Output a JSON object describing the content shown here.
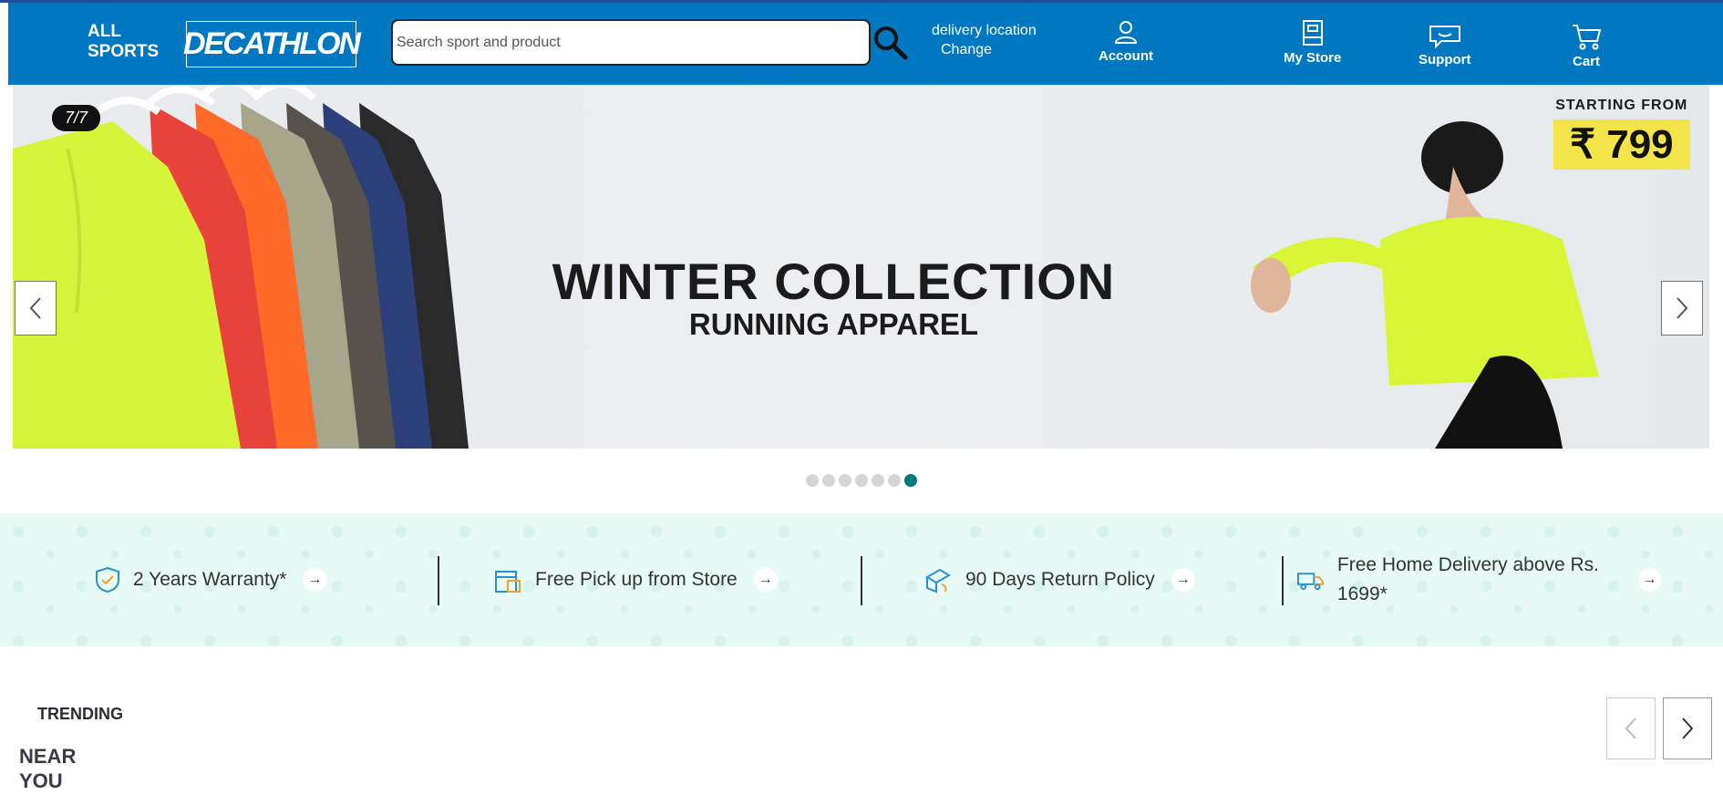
{
  "header": {
    "all_sports": "ALL SPORTS",
    "logo": "DECATHLON",
    "search_placeholder": "Search sport and product",
    "delivery_label": "delivery location",
    "delivery_change": "Change",
    "nav": [
      {
        "label": "Account",
        "icon": "user-icon"
      },
      {
        "label": "My Store",
        "icon": "store-icon"
      },
      {
        "label": "Support",
        "icon": "chat-icon"
      },
      {
        "label": "Cart",
        "icon": "cart-icon"
      }
    ]
  },
  "banner": {
    "pager": "7/7",
    "headline": "WINTER COLLECTION",
    "subheadline": "RUNNING APPAREL",
    "starting_from": "STARTING FROM",
    "price": "₹ 799",
    "dots_total": 7,
    "dots_active": 7
  },
  "features": [
    {
      "label": "2 Years Warranty*",
      "icon": "shield-check-icon"
    },
    {
      "label": "Free Pick up from Store",
      "icon": "store-pickup-icon"
    },
    {
      "label": "90 Days Return Policy",
      "icon": "return-box-icon"
    },
    {
      "label": "Free Home Delivery above Rs. 1699*",
      "icon": "delivery-truck-icon"
    }
  ],
  "section": {
    "trending": "TRENDING",
    "near_you": "NEAR YOU"
  },
  "colors": {
    "header_bg": "#0078c1",
    "features_bg": "#e8faf6",
    "active_dot": "#007a7a",
    "price_bg": "#f3e44a"
  }
}
